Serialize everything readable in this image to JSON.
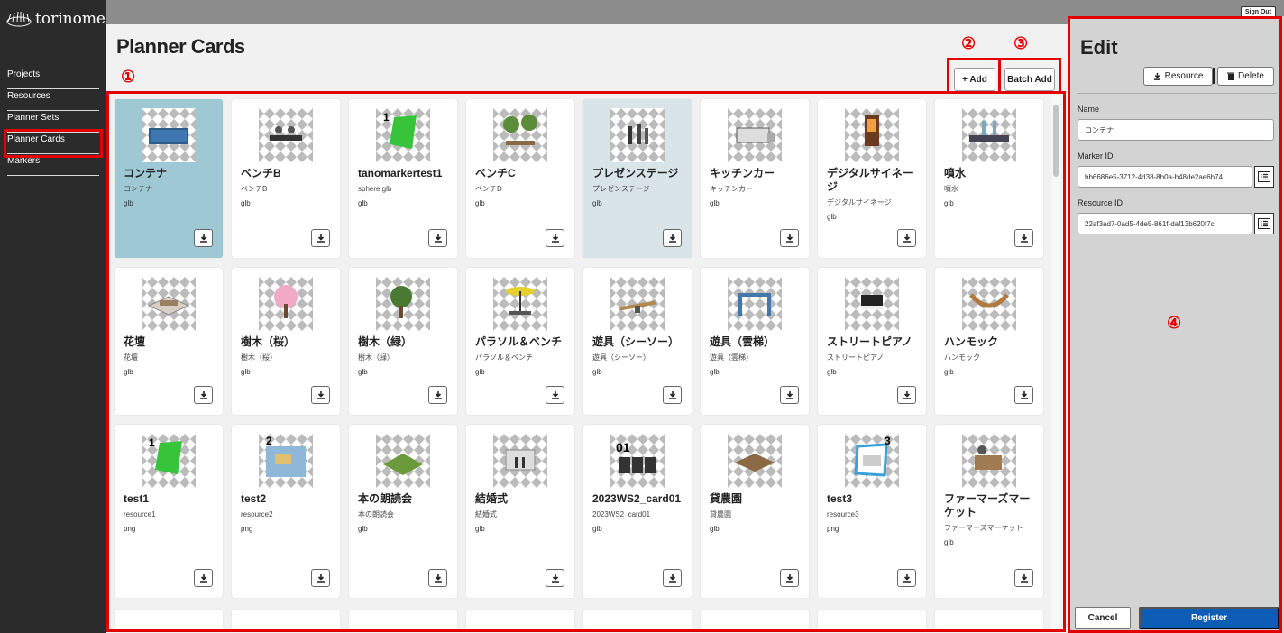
{
  "app": {
    "logo_text": "torinome",
    "sign_out": "Sign Out"
  },
  "sidebar": {
    "items": [
      {
        "label": "Projects",
        "active": false
      },
      {
        "label": "Resources",
        "active": false
      },
      {
        "label": "Planner Sets",
        "active": false
      },
      {
        "label": "Planner Cards",
        "active": true
      },
      {
        "label": "Markers",
        "active": false
      }
    ]
  },
  "main": {
    "title": "Planner Cards",
    "add_label": "+ Add",
    "batch_add_label": "Batch Add",
    "markers": {
      "m1": "①",
      "m2": "②",
      "m3": "③",
      "m4": "④"
    },
    "cards": [
      {
        "title": "コンテナ",
        "subtitle": "コンテナ",
        "type": "glb",
        "thumb": "container",
        "state": "selected"
      },
      {
        "title": "ベンチB",
        "subtitle": "ベンチB",
        "type": "glb",
        "thumb": "bench",
        "state": ""
      },
      {
        "title": "tanomarkertest1",
        "subtitle": "sphere.glb",
        "type": "glb",
        "thumb": "marker-green",
        "state": ""
      },
      {
        "title": "ベンチC",
        "subtitle": "ベンチD",
        "type": "glb",
        "thumb": "trees",
        "state": ""
      },
      {
        "title": "プレゼンステージ",
        "subtitle": "プレゼンステージ",
        "type": "glb",
        "thumb": "people",
        "state": "hover"
      },
      {
        "title": "キッチンカー",
        "subtitle": "キッチンカー",
        "type": "glb",
        "thumb": "truck",
        "state": ""
      },
      {
        "title": "デジタルサイネージ",
        "subtitle": "デジタルサイネージ",
        "type": "glb",
        "thumb": "signage",
        "state": ""
      },
      {
        "title": "噴水",
        "subtitle": "噴水",
        "type": "glb",
        "thumb": "fountain",
        "state": ""
      },
      {
        "title": "花壇",
        "subtitle": "花壇",
        "type": "glb",
        "thumb": "flowerbed",
        "state": ""
      },
      {
        "title": "樹木（桜）",
        "subtitle": "樹木（桜）",
        "type": "glb",
        "thumb": "sakura",
        "state": ""
      },
      {
        "title": "樹木（緑）",
        "subtitle": "樹木（緑）",
        "type": "glb",
        "thumb": "tree-green",
        "state": ""
      },
      {
        "title": "パラソル＆ベンチ",
        "subtitle": "パラソル＆ベンチ",
        "type": "glb",
        "thumb": "parasol",
        "state": ""
      },
      {
        "title": "遊具（シーソー）",
        "subtitle": "遊具（シーソー）",
        "type": "glb",
        "thumb": "seesaw",
        "state": ""
      },
      {
        "title": "遊具（雲梯）",
        "subtitle": "遊具（雲梯）",
        "type": "glb",
        "thumb": "monkeybars",
        "state": ""
      },
      {
        "title": "ストリートピアノ",
        "subtitle": "ストリートピアノ",
        "type": "glb",
        "thumb": "piano",
        "state": ""
      },
      {
        "title": "ハンモック",
        "subtitle": "ハンモック",
        "type": "glb",
        "thumb": "hammock",
        "state": ""
      },
      {
        "title": "test1",
        "subtitle": "resource1",
        "type": "png",
        "thumb": "marker-green",
        "state": ""
      },
      {
        "title": "test2",
        "subtitle": "resource2",
        "type": "png",
        "thumb": "map",
        "state": ""
      },
      {
        "title": "本の朗読会",
        "subtitle": "本の朗読会",
        "type": "glb",
        "thumb": "reading",
        "state": ""
      },
      {
        "title": "結婚式",
        "subtitle": "結婚式",
        "type": "glb",
        "thumb": "wedding",
        "state": ""
      },
      {
        "title": "2023WS2_card01",
        "subtitle": "2023WS2_card01",
        "type": "glb",
        "thumb": "houses",
        "state": ""
      },
      {
        "title": "貸農園",
        "subtitle": "貸農園",
        "type": "glb",
        "thumb": "farm",
        "state": ""
      },
      {
        "title": "test3",
        "subtitle": "resource3",
        "type": "png",
        "thumb": "marker-blue",
        "state": ""
      },
      {
        "title": "ファーマーズマーケット",
        "subtitle": "ファーマーズマーケット",
        "type": "glb",
        "thumb": "market",
        "state": ""
      }
    ]
  },
  "edit": {
    "title": "Edit",
    "resource_label": "Resource",
    "delete_label": "Delete",
    "name_label": "Name",
    "name_value": "コンテナ",
    "marker_id_label": "Marker ID",
    "marker_id_value": "bb6686e5-3712-4d38-8b0a-b48de2ae6b74",
    "resource_id_label": "Resource ID",
    "resource_id_value": "22af3ad7-0ad5-4de5-861f-daf13b620f7c",
    "cancel_label": "Cancel",
    "register_label": "Register"
  },
  "colors": {
    "annotation": "#e30000",
    "register": "#0d5cb6",
    "selected_card": "#9ec9d4"
  }
}
